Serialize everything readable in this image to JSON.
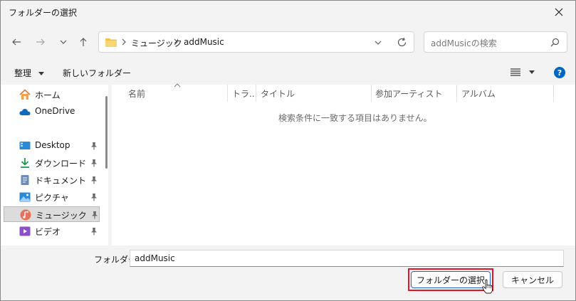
{
  "window": {
    "title": "フォルダーの選択"
  },
  "nav": {
    "breadcrumb": [
      "ミュージック",
      "addMusic"
    ]
  },
  "search": {
    "placeholder": "addMusicの検索"
  },
  "toolbar": {
    "organize_label": "整理",
    "new_folder_label": "新しいフォルダー"
  },
  "sidebar": {
    "items": [
      {
        "label": "ホーム",
        "icon": "home-icon"
      },
      {
        "label": "OneDrive",
        "icon": "cloud-icon"
      },
      {
        "label": "Desktop",
        "icon": "desktop-icon",
        "pinned": true
      },
      {
        "label": "ダウンロード",
        "icon": "download-icon",
        "pinned": true
      },
      {
        "label": "ドキュメント",
        "icon": "document-icon",
        "pinned": true
      },
      {
        "label": "ピクチャ",
        "icon": "pictures-icon",
        "pinned": true
      },
      {
        "label": "ミュージック",
        "icon": "music-icon",
        "pinned": true,
        "selected": true
      },
      {
        "label": "ビデオ",
        "icon": "video-icon",
        "pinned": true
      }
    ]
  },
  "columns": [
    "名前",
    "トラ...",
    "タイトル",
    "参加アーティスト",
    "アルバム"
  ],
  "empty_message": "検索条件に一致する項目はありません。",
  "footer": {
    "folder_label": "フォルダー:",
    "folder_value": "addMusic",
    "select_label": "フォルダーの選択",
    "cancel_label": "キャンセル"
  },
  "colors": {
    "accent": "#2a63c6",
    "highlight_border": "#e0142a",
    "help": "#0067c0"
  }
}
